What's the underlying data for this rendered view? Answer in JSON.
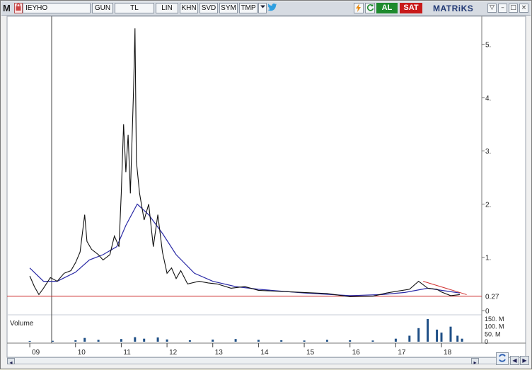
{
  "toolbar": {
    "app_letter": "M",
    "symbol": "IEYHO",
    "period": "GUN",
    "currency": "TL",
    "buttons": [
      "LIN",
      "KHN",
      "SVD",
      "SYM",
      "TMP"
    ],
    "buy_label": "AL",
    "sell_label": "SAT",
    "brand": "MATRiKS"
  },
  "chart_data": {
    "type": "line",
    "title": "",
    "x_tick_labels": [
      "09",
      "10",
      "11",
      "12",
      "13",
      "14",
      "15",
      "16",
      "17",
      "18"
    ],
    "y_tick_labels": [
      "0",
      "1.",
      "2.",
      "3.",
      "4.",
      "5."
    ],
    "ylim": [
      0,
      5.5
    ],
    "support_line_value": 0.27,
    "support_line_label": "0.27",
    "volume_panel_label": "Volume",
    "volume_tick_labels": [
      "150. M",
      "100. M",
      "50. M",
      "0"
    ],
    "volume_ylim": [
      0,
      150
    ],
    "price_series": [
      [
        2009.0,
        0.65
      ],
      [
        2009.1,
        0.45
      ],
      [
        2009.2,
        0.3
      ],
      [
        2009.3,
        0.42
      ],
      [
        2009.45,
        0.62
      ],
      [
        2009.6,
        0.55
      ],
      [
        2009.75,
        0.7
      ],
      [
        2009.9,
        0.75
      ],
      [
        2010.0,
        0.9
      ],
      [
        2010.1,
        1.1
      ],
      [
        2010.2,
        1.8
      ],
      [
        2010.25,
        1.3
      ],
      [
        2010.35,
        1.15
      ],
      [
        2010.5,
        1.05
      ],
      [
        2010.6,
        0.95
      ],
      [
        2010.75,
        1.05
      ],
      [
        2010.85,
        1.4
      ],
      [
        2010.95,
        1.2
      ],
      [
        2011.0,
        2.2
      ],
      [
        2011.05,
        3.5
      ],
      [
        2011.1,
        2.6
      ],
      [
        2011.15,
        3.3
      ],
      [
        2011.2,
        2.2
      ],
      [
        2011.27,
        4.2
      ],
      [
        2011.3,
        5.3
      ],
      [
        2011.33,
        2.8
      ],
      [
        2011.4,
        2.2
      ],
      [
        2011.5,
        1.7
      ],
      [
        2011.6,
        2.0
      ],
      [
        2011.7,
        1.2
      ],
      [
        2011.8,
        1.8
      ],
      [
        2011.9,
        1.1
      ],
      [
        2012.0,
        0.7
      ],
      [
        2012.1,
        0.8
      ],
      [
        2012.2,
        0.6
      ],
      [
        2012.3,
        0.75
      ],
      [
        2012.45,
        0.5
      ],
      [
        2012.7,
        0.55
      ],
      [
        2012.9,
        0.52
      ],
      [
        2013.1,
        0.5
      ],
      [
        2013.4,
        0.42
      ],
      [
        2013.7,
        0.45
      ],
      [
        2014.0,
        0.38
      ],
      [
        2014.5,
        0.36
      ],
      [
        2015.0,
        0.34
      ],
      [
        2015.5,
        0.32
      ],
      [
        2016.0,
        0.26
      ],
      [
        2016.5,
        0.27
      ],
      [
        2016.8,
        0.33
      ],
      [
        2017.0,
        0.36
      ],
      [
        2017.3,
        0.4
      ],
      [
        2017.5,
        0.55
      ],
      [
        2017.7,
        0.42
      ],
      [
        2017.9,
        0.4
      ],
      [
        2018.0,
        0.35
      ],
      [
        2018.2,
        0.28
      ],
      [
        2018.4,
        0.3
      ]
    ],
    "moving_average_series": [
      [
        2009.0,
        0.8
      ],
      [
        2009.3,
        0.55
      ],
      [
        2009.6,
        0.55
      ],
      [
        2010.0,
        0.72
      ],
      [
        2010.3,
        0.95
      ],
      [
        2010.6,
        1.05
      ],
      [
        2010.9,
        1.2
      ],
      [
        2011.1,
        1.6
      ],
      [
        2011.35,
        2.0
      ],
      [
        2011.6,
        1.8
      ],
      [
        2011.9,
        1.45
      ],
      [
        2012.2,
        1.05
      ],
      [
        2012.6,
        0.7
      ],
      [
        2013.0,
        0.55
      ],
      [
        2013.5,
        0.45
      ],
      [
        2014.0,
        0.4
      ],
      [
        2015.0,
        0.33
      ],
      [
        2016.0,
        0.28
      ],
      [
        2016.7,
        0.3
      ],
      [
        2017.2,
        0.34
      ],
      [
        2017.7,
        0.42
      ],
      [
        2018.0,
        0.38
      ],
      [
        2018.4,
        0.33
      ]
    ],
    "trend_line": [
      [
        2017.6,
        0.55
      ],
      [
        2018.55,
        0.3
      ]
    ],
    "volume_series": [
      [
        2009.0,
        5
      ],
      [
        2009.5,
        6
      ],
      [
        2010.0,
        10
      ],
      [
        2010.2,
        25
      ],
      [
        2010.5,
        12
      ],
      [
        2011.0,
        18
      ],
      [
        2011.3,
        30
      ],
      [
        2011.5,
        20
      ],
      [
        2011.8,
        28
      ],
      [
        2012.0,
        15
      ],
      [
        2012.5,
        10
      ],
      [
        2013.0,
        14
      ],
      [
        2013.5,
        18
      ],
      [
        2014.0,
        12
      ],
      [
        2014.5,
        10
      ],
      [
        2015.0,
        8
      ],
      [
        2015.5,
        12
      ],
      [
        2016.0,
        10
      ],
      [
        2016.5,
        8
      ],
      [
        2017.0,
        20
      ],
      [
        2017.3,
        40
      ],
      [
        2017.5,
        90
      ],
      [
        2017.7,
        150
      ],
      [
        2017.9,
        80
      ],
      [
        2018.0,
        60
      ],
      [
        2018.2,
        100
      ],
      [
        2018.35,
        40
      ],
      [
        2018.45,
        20
      ]
    ]
  }
}
